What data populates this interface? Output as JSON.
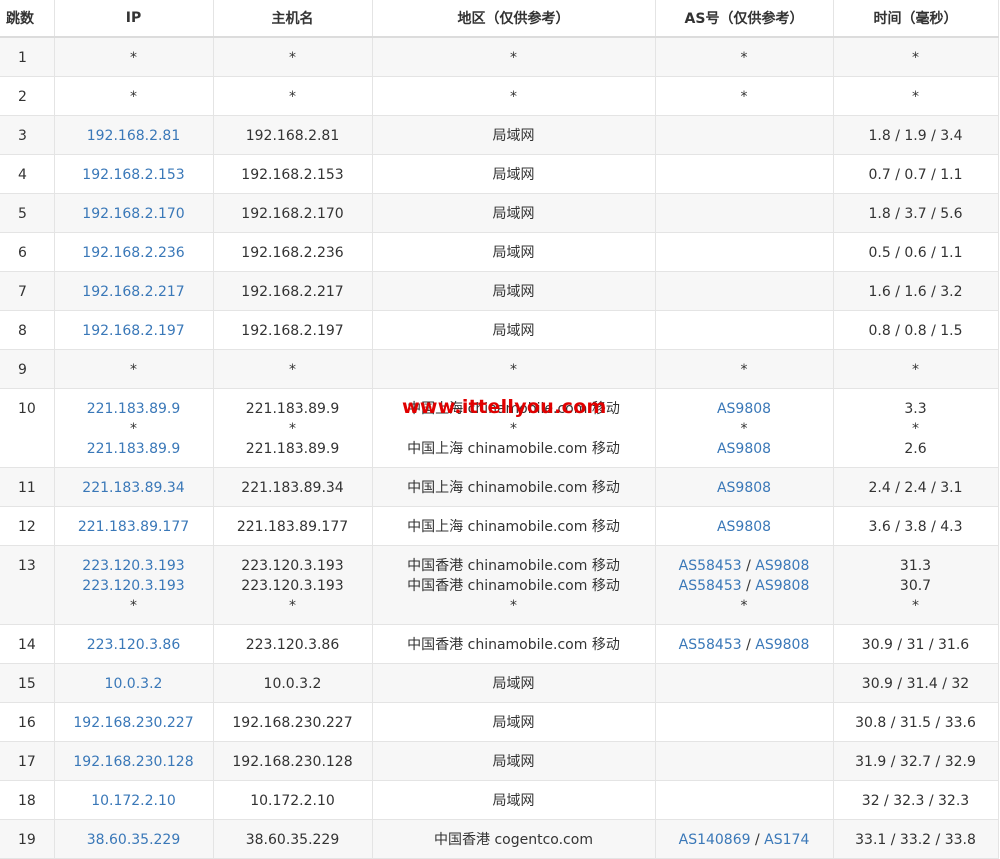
{
  "headers": [
    "跳数",
    "IP",
    "主机名",
    "地区（仅供参考）",
    "AS号（仅供参考）",
    "时间（毫秒）"
  ],
  "watermark": "www.ittellyou.com",
  "rows": [
    {
      "hop": "1",
      "alt": true,
      "lines": [
        {
          "ip": "*",
          "host": "*",
          "region": "*",
          "as": [
            "*"
          ],
          "time": "*"
        }
      ]
    },
    {
      "hop": "2",
      "alt": false,
      "lines": [
        {
          "ip": "*",
          "host": "*",
          "region": "*",
          "as": [
            "*"
          ],
          "time": "*"
        }
      ]
    },
    {
      "hop": "3",
      "alt": true,
      "lines": [
        {
          "ip": "192.168.2.81",
          "host": "192.168.2.81",
          "region": "局域网",
          "as": [],
          "time": "1.8 / 1.9 / 3.4"
        }
      ]
    },
    {
      "hop": "4",
      "alt": false,
      "lines": [
        {
          "ip": "192.168.2.153",
          "host": "192.168.2.153",
          "region": "局域网",
          "as": [],
          "time": "0.7 / 0.7 / 1.1"
        }
      ]
    },
    {
      "hop": "5",
      "alt": true,
      "lines": [
        {
          "ip": "192.168.2.170",
          "host": "192.168.2.170",
          "region": "局域网",
          "as": [],
          "time": "1.8 / 3.7 / 5.6"
        }
      ]
    },
    {
      "hop": "6",
      "alt": false,
      "lines": [
        {
          "ip": "192.168.2.236",
          "host": "192.168.2.236",
          "region": "局域网",
          "as": [],
          "time": "0.5 / 0.6 / 1.1"
        }
      ]
    },
    {
      "hop": "7",
      "alt": true,
      "lines": [
        {
          "ip": "192.168.2.217",
          "host": "192.168.2.217",
          "region": "局域网",
          "as": [],
          "time": "1.6 / 1.6 / 3.2"
        }
      ]
    },
    {
      "hop": "8",
      "alt": false,
      "lines": [
        {
          "ip": "192.168.2.197",
          "host": "192.168.2.197",
          "region": "局域网",
          "as": [],
          "time": "0.8 / 0.8 / 1.5"
        }
      ]
    },
    {
      "hop": "9",
      "alt": true,
      "lines": [
        {
          "ip": "*",
          "host": "*",
          "region": "*",
          "as": [
            "*"
          ],
          "time": "*"
        }
      ]
    },
    {
      "hop": "10",
      "alt": false,
      "lines": [
        {
          "ip": "221.183.89.9",
          "host": "221.183.89.9",
          "region": "中国上海 chinamobile.com 移动",
          "as": [
            "AS9808"
          ],
          "time": "3.3"
        },
        {
          "ip": "*",
          "host": "*",
          "region": "*",
          "as": [
            "*"
          ],
          "time": "*"
        },
        {
          "ip": "221.183.89.9",
          "host": "221.183.89.9",
          "region": "中国上海 chinamobile.com 移动",
          "as": [
            "AS9808"
          ],
          "time": "2.6"
        }
      ]
    },
    {
      "hop": "11",
      "alt": true,
      "lines": [
        {
          "ip": "221.183.89.34",
          "host": "221.183.89.34",
          "region": "中国上海 chinamobile.com 移动",
          "as": [
            "AS9808"
          ],
          "time": "2.4 / 2.4 / 3.1"
        }
      ]
    },
    {
      "hop": "12",
      "alt": false,
      "lines": [
        {
          "ip": "221.183.89.177",
          "host": "221.183.89.177",
          "region": "中国上海 chinamobile.com 移动",
          "as": [
            "AS9808"
          ],
          "time": "3.6 / 3.8 / 4.3"
        }
      ]
    },
    {
      "hop": "13",
      "alt": true,
      "lines": [
        {
          "ip": "223.120.3.193",
          "host": "223.120.3.193",
          "region": "中国香港 chinamobile.com 移动",
          "as": [
            "AS58453",
            "AS9808"
          ],
          "time": "31.3"
        },
        {
          "ip": "223.120.3.193",
          "host": "223.120.3.193",
          "region": "中国香港 chinamobile.com 移动",
          "as": [
            "AS58453",
            "AS9808"
          ],
          "time": "30.7"
        },
        {
          "ip": "*",
          "host": "*",
          "region": "*",
          "as": [
            "*"
          ],
          "time": "*"
        }
      ]
    },
    {
      "hop": "14",
      "alt": false,
      "lines": [
        {
          "ip": "223.120.3.86",
          "host": "223.120.3.86",
          "region": "中国香港 chinamobile.com 移动",
          "as": [
            "AS58453",
            "AS9808"
          ],
          "time": "30.9 / 31 / 31.6"
        }
      ]
    },
    {
      "hop": "15",
      "alt": true,
      "lines": [
        {
          "ip": "10.0.3.2",
          "host": "10.0.3.2",
          "region": "局域网",
          "as": [],
          "time": "30.9 / 31.4 / 32"
        }
      ]
    },
    {
      "hop": "16",
      "alt": false,
      "lines": [
        {
          "ip": "192.168.230.227",
          "host": "192.168.230.227",
          "region": "局域网",
          "as": [],
          "time": "30.8 / 31.5 / 33.6"
        }
      ]
    },
    {
      "hop": "17",
      "alt": true,
      "lines": [
        {
          "ip": "192.168.230.128",
          "host": "192.168.230.128",
          "region": "局域网",
          "as": [],
          "time": "31.9 / 32.7 / 32.9"
        }
      ]
    },
    {
      "hop": "18",
      "alt": false,
      "lines": [
        {
          "ip": "10.172.2.10",
          "host": "10.172.2.10",
          "region": "局域网",
          "as": [],
          "time": "32 / 32.3 / 32.3"
        }
      ]
    },
    {
      "hop": "19",
      "alt": true,
      "lines": [
        {
          "ip": "38.60.35.229",
          "host": "38.60.35.229",
          "region": "中国香港 cogentco.com",
          "as": [
            "AS140869",
            "AS174"
          ],
          "time": "33.1 / 33.2 / 33.8"
        }
      ]
    }
  ]
}
